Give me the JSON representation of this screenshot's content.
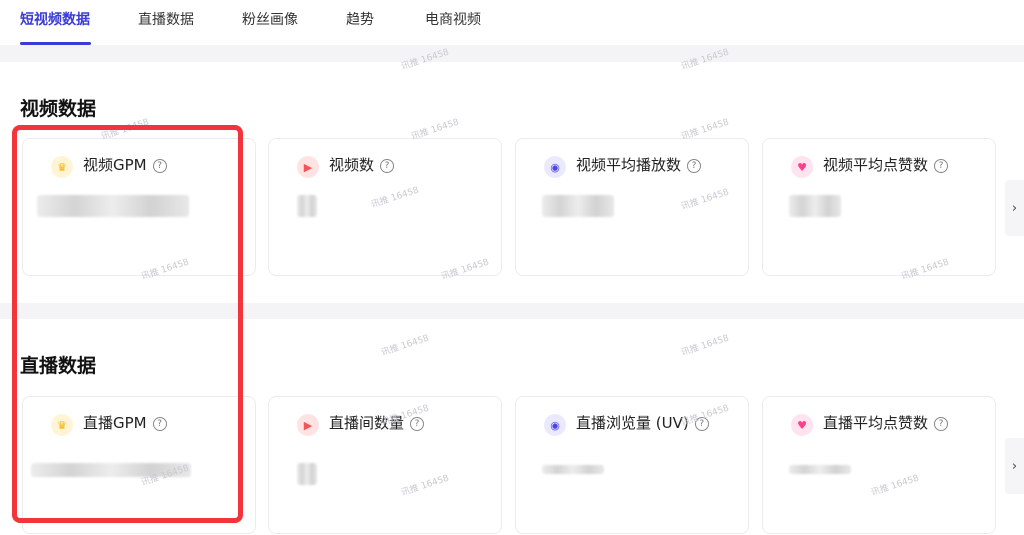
{
  "tabs": [
    {
      "label": "短视频数据",
      "active": true
    },
    {
      "label": "直播数据",
      "active": false
    },
    {
      "label": "粉丝画像",
      "active": false
    },
    {
      "label": "趋势",
      "active": false
    },
    {
      "label": "电商视频",
      "active": false
    }
  ],
  "sections": {
    "video": {
      "title": "视频数据",
      "cards": [
        {
          "label": "视频GPM",
          "icon": "crown-icon"
        },
        {
          "label": "视频数",
          "icon": "play-icon"
        },
        {
          "label": "视频平均播放数",
          "icon": "eye-icon"
        },
        {
          "label": "视频平均点赞数",
          "icon": "heart-icon"
        }
      ]
    },
    "live": {
      "title": "直播数据",
      "cards": [
        {
          "label": "直播GPM",
          "icon": "crown-icon"
        },
        {
          "label": "直播间数量",
          "icon": "play-icon"
        },
        {
          "label": "直播浏览量 (UV)",
          "icon": "eye-icon"
        },
        {
          "label": "直播平均点赞数",
          "icon": "heart-icon"
        }
      ]
    }
  },
  "help_glyph": "?",
  "next_glyph": "›",
  "watermark": "讯推 16458",
  "colors": {
    "accent": "#3b3bd6",
    "highlight": "#f2343d"
  }
}
